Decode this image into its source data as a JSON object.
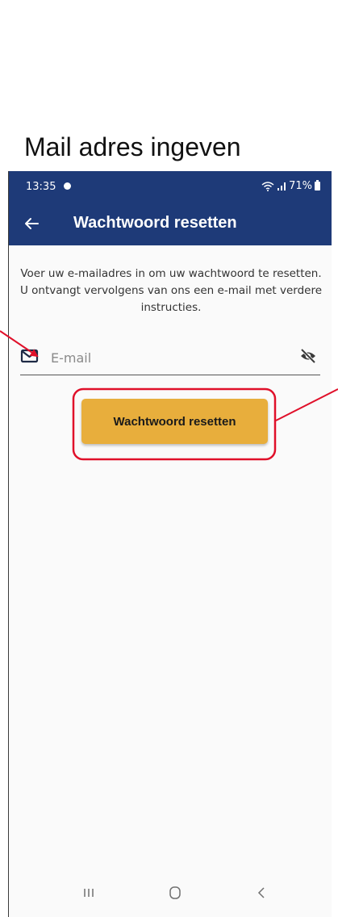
{
  "caption": "Mail adres ingeven",
  "status_bar": {
    "time": "13:35",
    "battery": "71%"
  },
  "app_bar": {
    "title": "Wachtwoord resetten"
  },
  "instructions": "Voer uw e-mailadres in om uw wachtwoord te resetten. U ontvangt vervolgens van ons een e-mail met verdere instructies.",
  "email_field": {
    "value": "",
    "placeholder": "E-mail"
  },
  "reset_button": {
    "label": "Wachtwoord resetten"
  },
  "icons": {
    "back": "arrow-left-icon",
    "mail": "mail-icon",
    "visibility": "eye-off-icon",
    "nav_recents": "recent-apps-icon",
    "nav_home": "home-icon",
    "nav_back": "back-chevron-icon"
  },
  "colors": {
    "header": "#1e3a78",
    "button": "#e8ae3c",
    "annotation": "#e0102a"
  }
}
